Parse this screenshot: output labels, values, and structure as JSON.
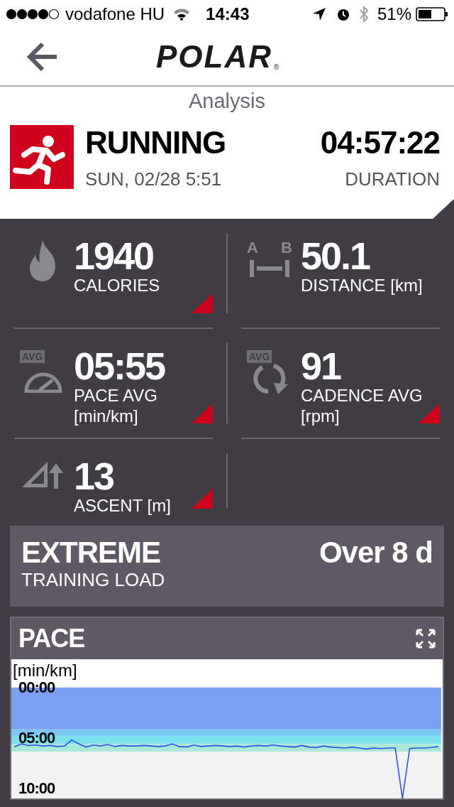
{
  "status_bar": {
    "carrier": "vodafone HU",
    "time": "14:43",
    "battery": "51%"
  },
  "nav": {
    "logo": "POLAR",
    "logo_mark": "®"
  },
  "page_title": "Analysis",
  "session": {
    "sport": "RUNNING",
    "date": "SUN, 02/28 5:51",
    "duration": "04:57:22",
    "duration_label": "DURATION"
  },
  "stats": [
    {
      "kind": "calories",
      "value": "1940",
      "label": "CALORIES",
      "expandable": true
    },
    {
      "kind": "distance",
      "value": "50.1",
      "label": "DISTANCE [km]",
      "icon_text": [
        "A",
        "B"
      ],
      "expandable": false
    },
    {
      "kind": "pace",
      "value": "05:55",
      "label": "PACE AVG",
      "unit": "[min/km]",
      "icon_text": [
        "AVG"
      ],
      "expandable": true
    },
    {
      "kind": "cadence",
      "value": "91",
      "label": "CADENCE AVG",
      "unit": "[rpm]",
      "icon_text": [
        "AVG"
      ],
      "expandable": true
    },
    {
      "kind": "ascent",
      "value": "13",
      "label": "ASCENT [m]",
      "expandable": true
    }
  ],
  "training_load": {
    "level": "EXTREME",
    "label": "TRAINING LOAD",
    "recovery": "Over 8 d"
  },
  "pace_chart": {
    "title": "PACE",
    "chart_data": {
      "type": "line",
      "ylabel": "[min/km]",
      "ylim": [
        11,
        -2.8
      ],
      "yticks": [
        {
          "value": 0,
          "label": "00:00"
        },
        {
          "value": 5,
          "label": "05:00"
        },
        {
          "value": 10,
          "label": "10:00"
        }
      ],
      "series": [
        {
          "color": "#2f4fe0",
          "values": [
            5.9,
            5.6,
            5.75,
            5.7,
            5.8,
            5.75,
            5.85,
            5.8,
            5.2,
            5.6,
            5.9,
            5.7,
            5.8,
            5.65,
            5.85,
            5.75,
            5.8,
            5.8,
            5.75,
            5.8,
            5.85,
            5.8,
            5.6,
            5.85,
            5.9,
            5.7,
            5.85,
            5.8,
            5.75,
            5.8,
            5.85,
            5.8,
            5.9,
            5.8,
            5.75,
            5.8,
            5.7,
            5.8,
            5.85,
            5.9,
            5.75,
            5.9,
            5.95,
            5.8,
            5.9,
            5.95,
            6.0,
            5.9,
            6.0,
            6.1,
            6.0,
            6.05,
            6.0,
            6.0,
            11,
            6.05,
            6.0,
            6.0,
            5.95,
            5.85
          ]
        }
      ]
    }
  }
}
